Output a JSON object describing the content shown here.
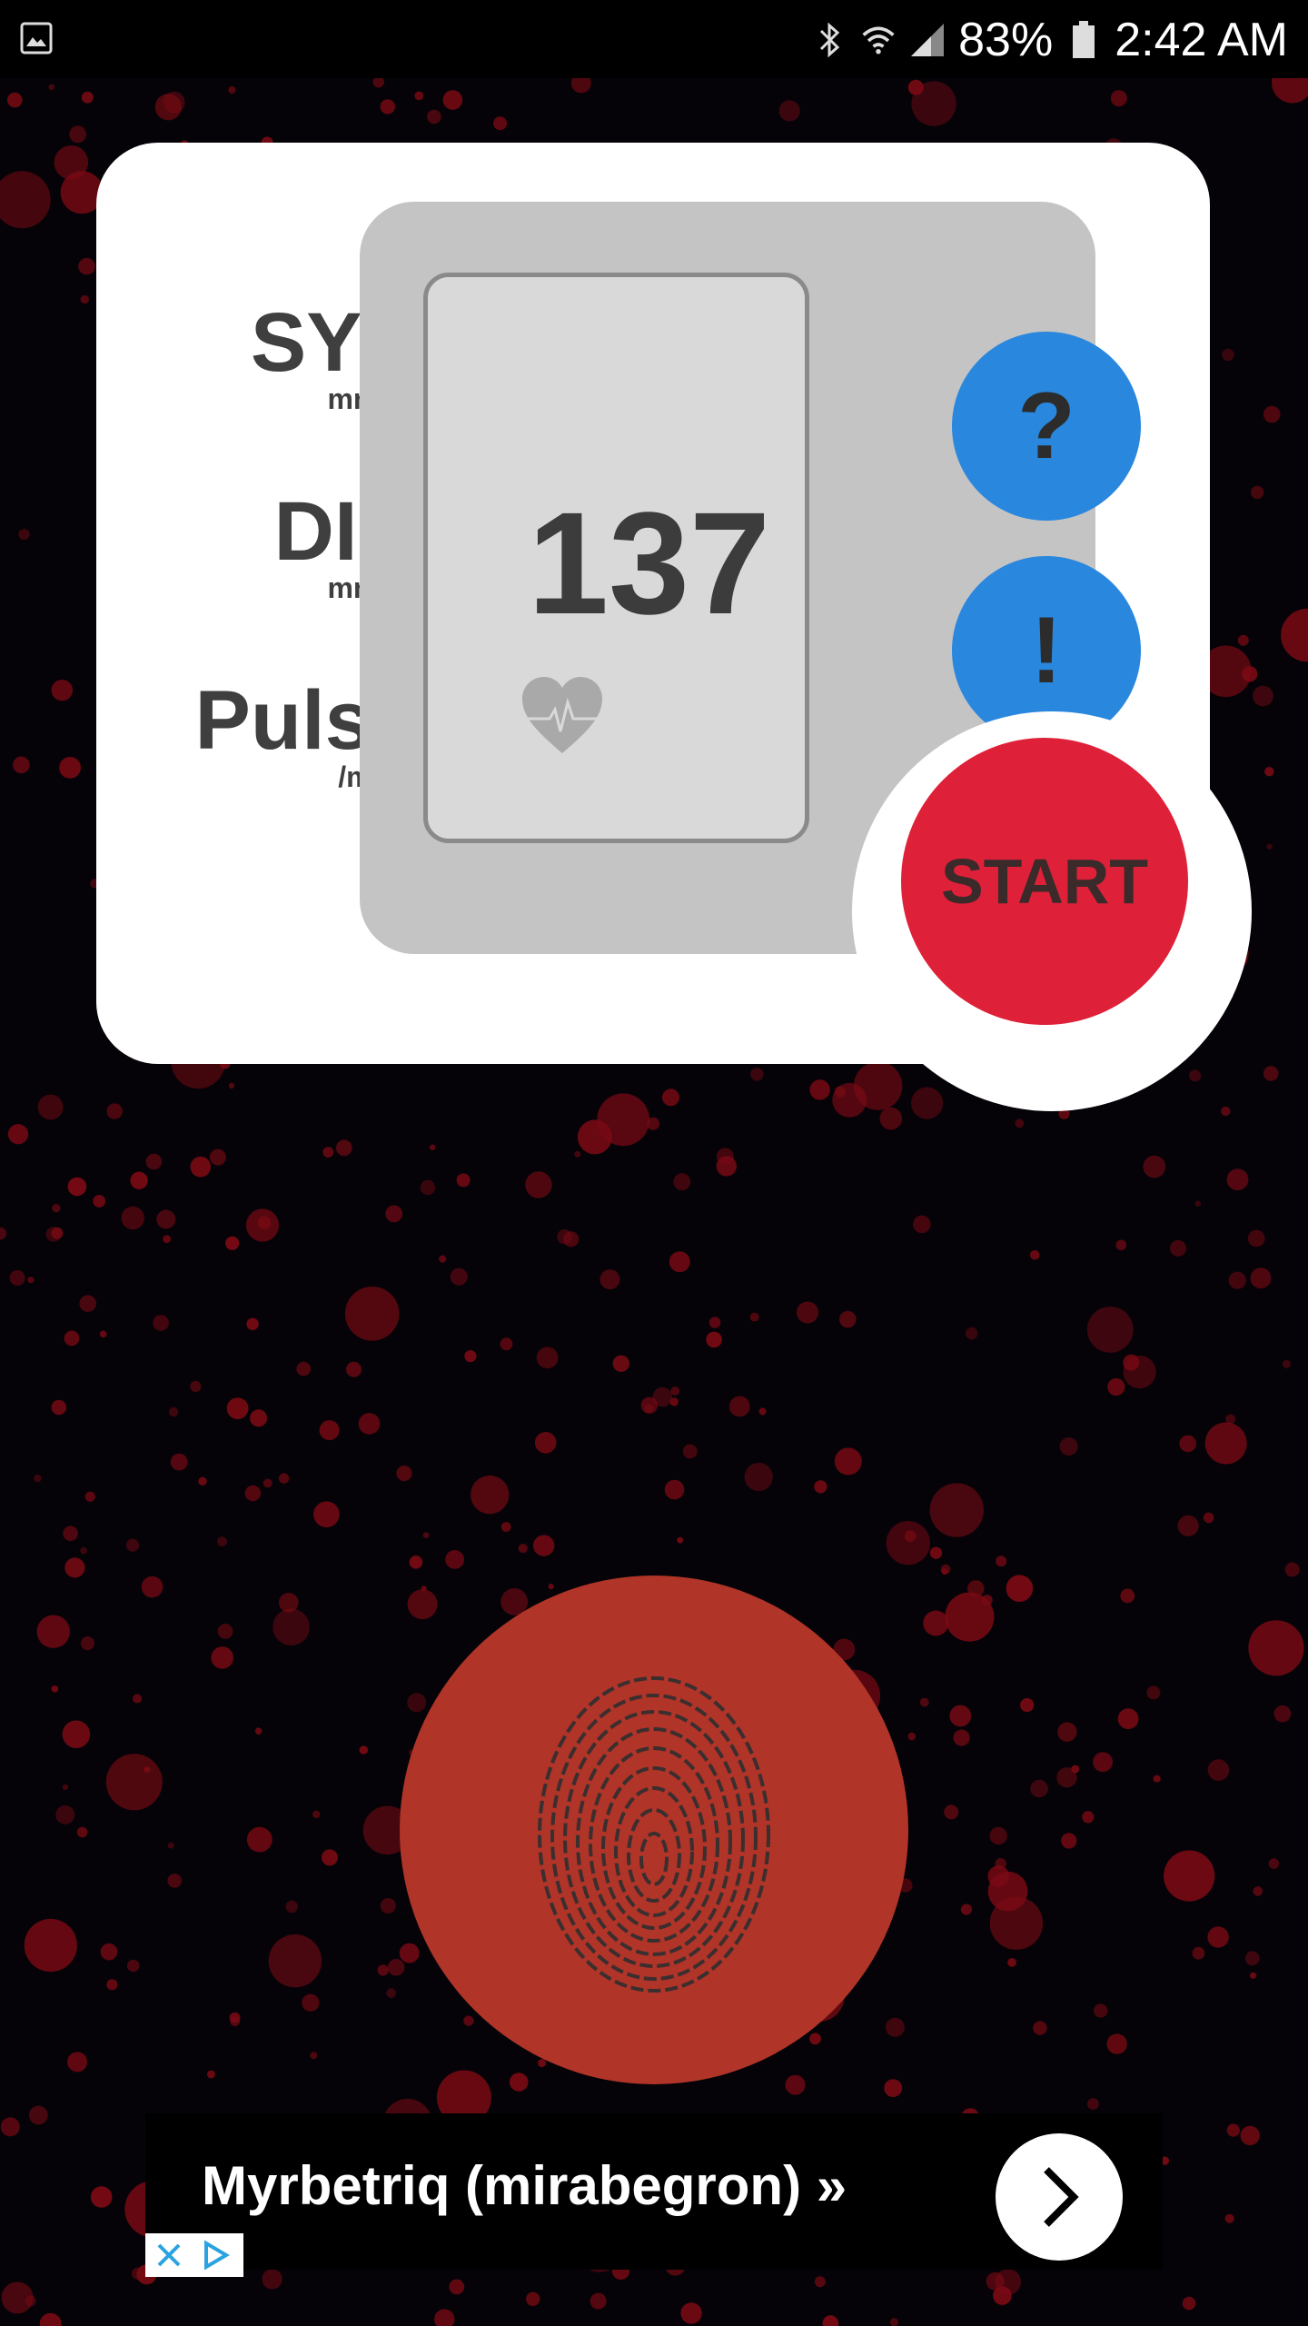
{
  "status_bar": {
    "battery": "83%",
    "time": "2:42 AM",
    "icons": [
      "gallery-icon",
      "bluetooth-icon",
      "wifi-icon",
      "signal-icon",
      "battery-icon"
    ]
  },
  "monitor": {
    "sys_label": "SYS",
    "sys_unit": "mmHg",
    "dia_label": "DIA",
    "dia_unit": "mmHg",
    "pulse_label": "Pulse",
    "pulse_unit": "/min",
    "reading": "137",
    "help_button": "?",
    "info_button": "!",
    "start_button": "START"
  },
  "ad": {
    "text": "Myrbetriq (mirabegron) »",
    "close_icon": "close-icon",
    "adchoices_icon": "adchoices-icon",
    "arrow_icon": "chevron-right-icon"
  },
  "colors": {
    "background": "#050308",
    "accent_blue": "#2a87de",
    "start_red": "#df2039",
    "finger_circle": "#b03428",
    "dots": "#7a0a14"
  }
}
